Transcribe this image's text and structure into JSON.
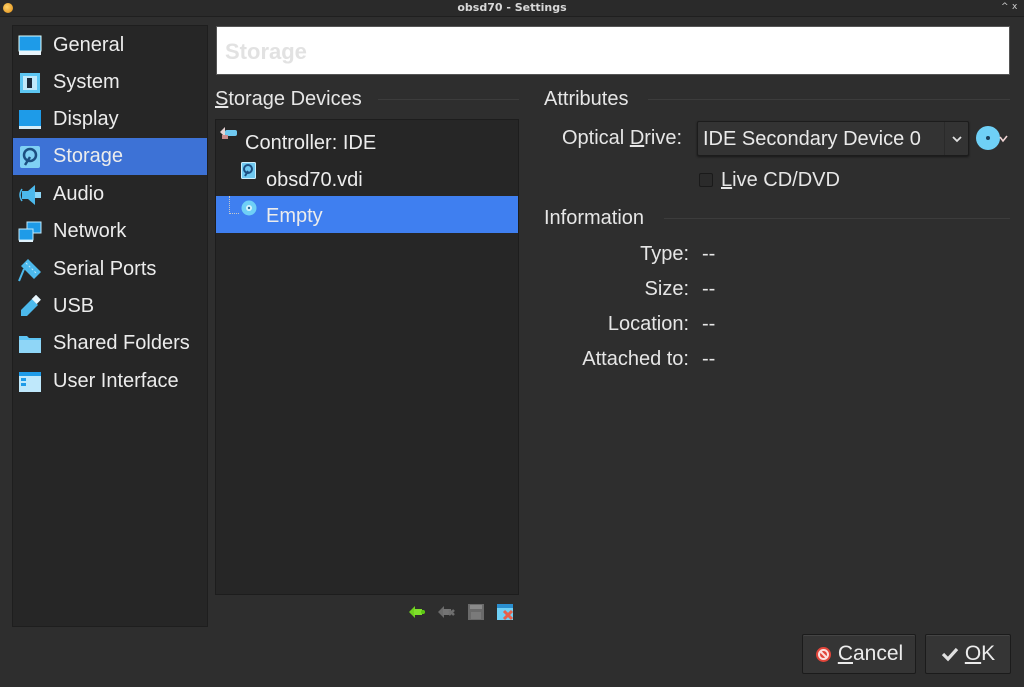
{
  "window": {
    "title": "obsd70 - Settings",
    "maximize_icon": "^",
    "close_icon": "x"
  },
  "sidebar": {
    "items": [
      {
        "label": "General",
        "icon": "general-icon"
      },
      {
        "label": "System",
        "icon": "system-icon"
      },
      {
        "label": "Display",
        "icon": "display-icon"
      },
      {
        "label": "Storage",
        "icon": "storage-icon",
        "selected": true
      },
      {
        "label": "Audio",
        "icon": "audio-icon"
      },
      {
        "label": "Network",
        "icon": "network-icon"
      },
      {
        "label": "Serial Ports",
        "icon": "serial-ports-icon"
      },
      {
        "label": "USB",
        "icon": "usb-icon"
      },
      {
        "label": "Shared Folders",
        "icon": "shared-folders-icon"
      },
      {
        "label": "User Interface",
        "icon": "user-interface-icon"
      }
    ]
  },
  "header": {
    "title": "Storage"
  },
  "storage_devices": {
    "title_mnemonic": "S",
    "title_rest": "torage Devices",
    "tree": [
      {
        "label": "Controller: IDE",
        "icon": "ide-controller-icon",
        "level": 0
      },
      {
        "label": "obsd70.vdi",
        "icon": "hard-disk-icon",
        "level": 1
      },
      {
        "label": "Empty",
        "icon": "optical-disc-icon",
        "level": 1,
        "selected": true
      }
    ],
    "toolbar": [
      {
        "name": "add-controller",
        "icon": "add-controller-icon",
        "enabled": true
      },
      {
        "name": "remove-controller",
        "icon": "remove-controller-icon",
        "enabled": false
      },
      {
        "name": "add-attachment",
        "icon": "add-attachment-icon",
        "enabled": false
      },
      {
        "name": "remove-attachment",
        "icon": "remove-attachment-icon",
        "enabled": true
      }
    ]
  },
  "attributes": {
    "title": "Attributes",
    "optical_drive_label_pre": "Optical ",
    "optical_drive_label_mnemonic": "D",
    "optical_drive_label_post": "rive:",
    "optical_drive_value": "IDE Secondary Device 0",
    "live_cd_mnemonic": "L",
    "live_cd_rest": "ive CD/DVD",
    "live_cd_checked": false
  },
  "information": {
    "title": "Information",
    "rows": [
      {
        "label": "Type:",
        "value": "--"
      },
      {
        "label": "Size:",
        "value": "--"
      },
      {
        "label": "Location:",
        "value": "--"
      },
      {
        "label": "Attached to:",
        "value": "--"
      }
    ]
  },
  "buttons": {
    "cancel_mnemonic": "C",
    "cancel_rest": "ancel",
    "ok_mnemonic": "O",
    "ok_rest": "K"
  },
  "colors": {
    "selection": "#3d72d6",
    "tree_selection": "#3f7ff0",
    "background": "#2e2e2e"
  }
}
